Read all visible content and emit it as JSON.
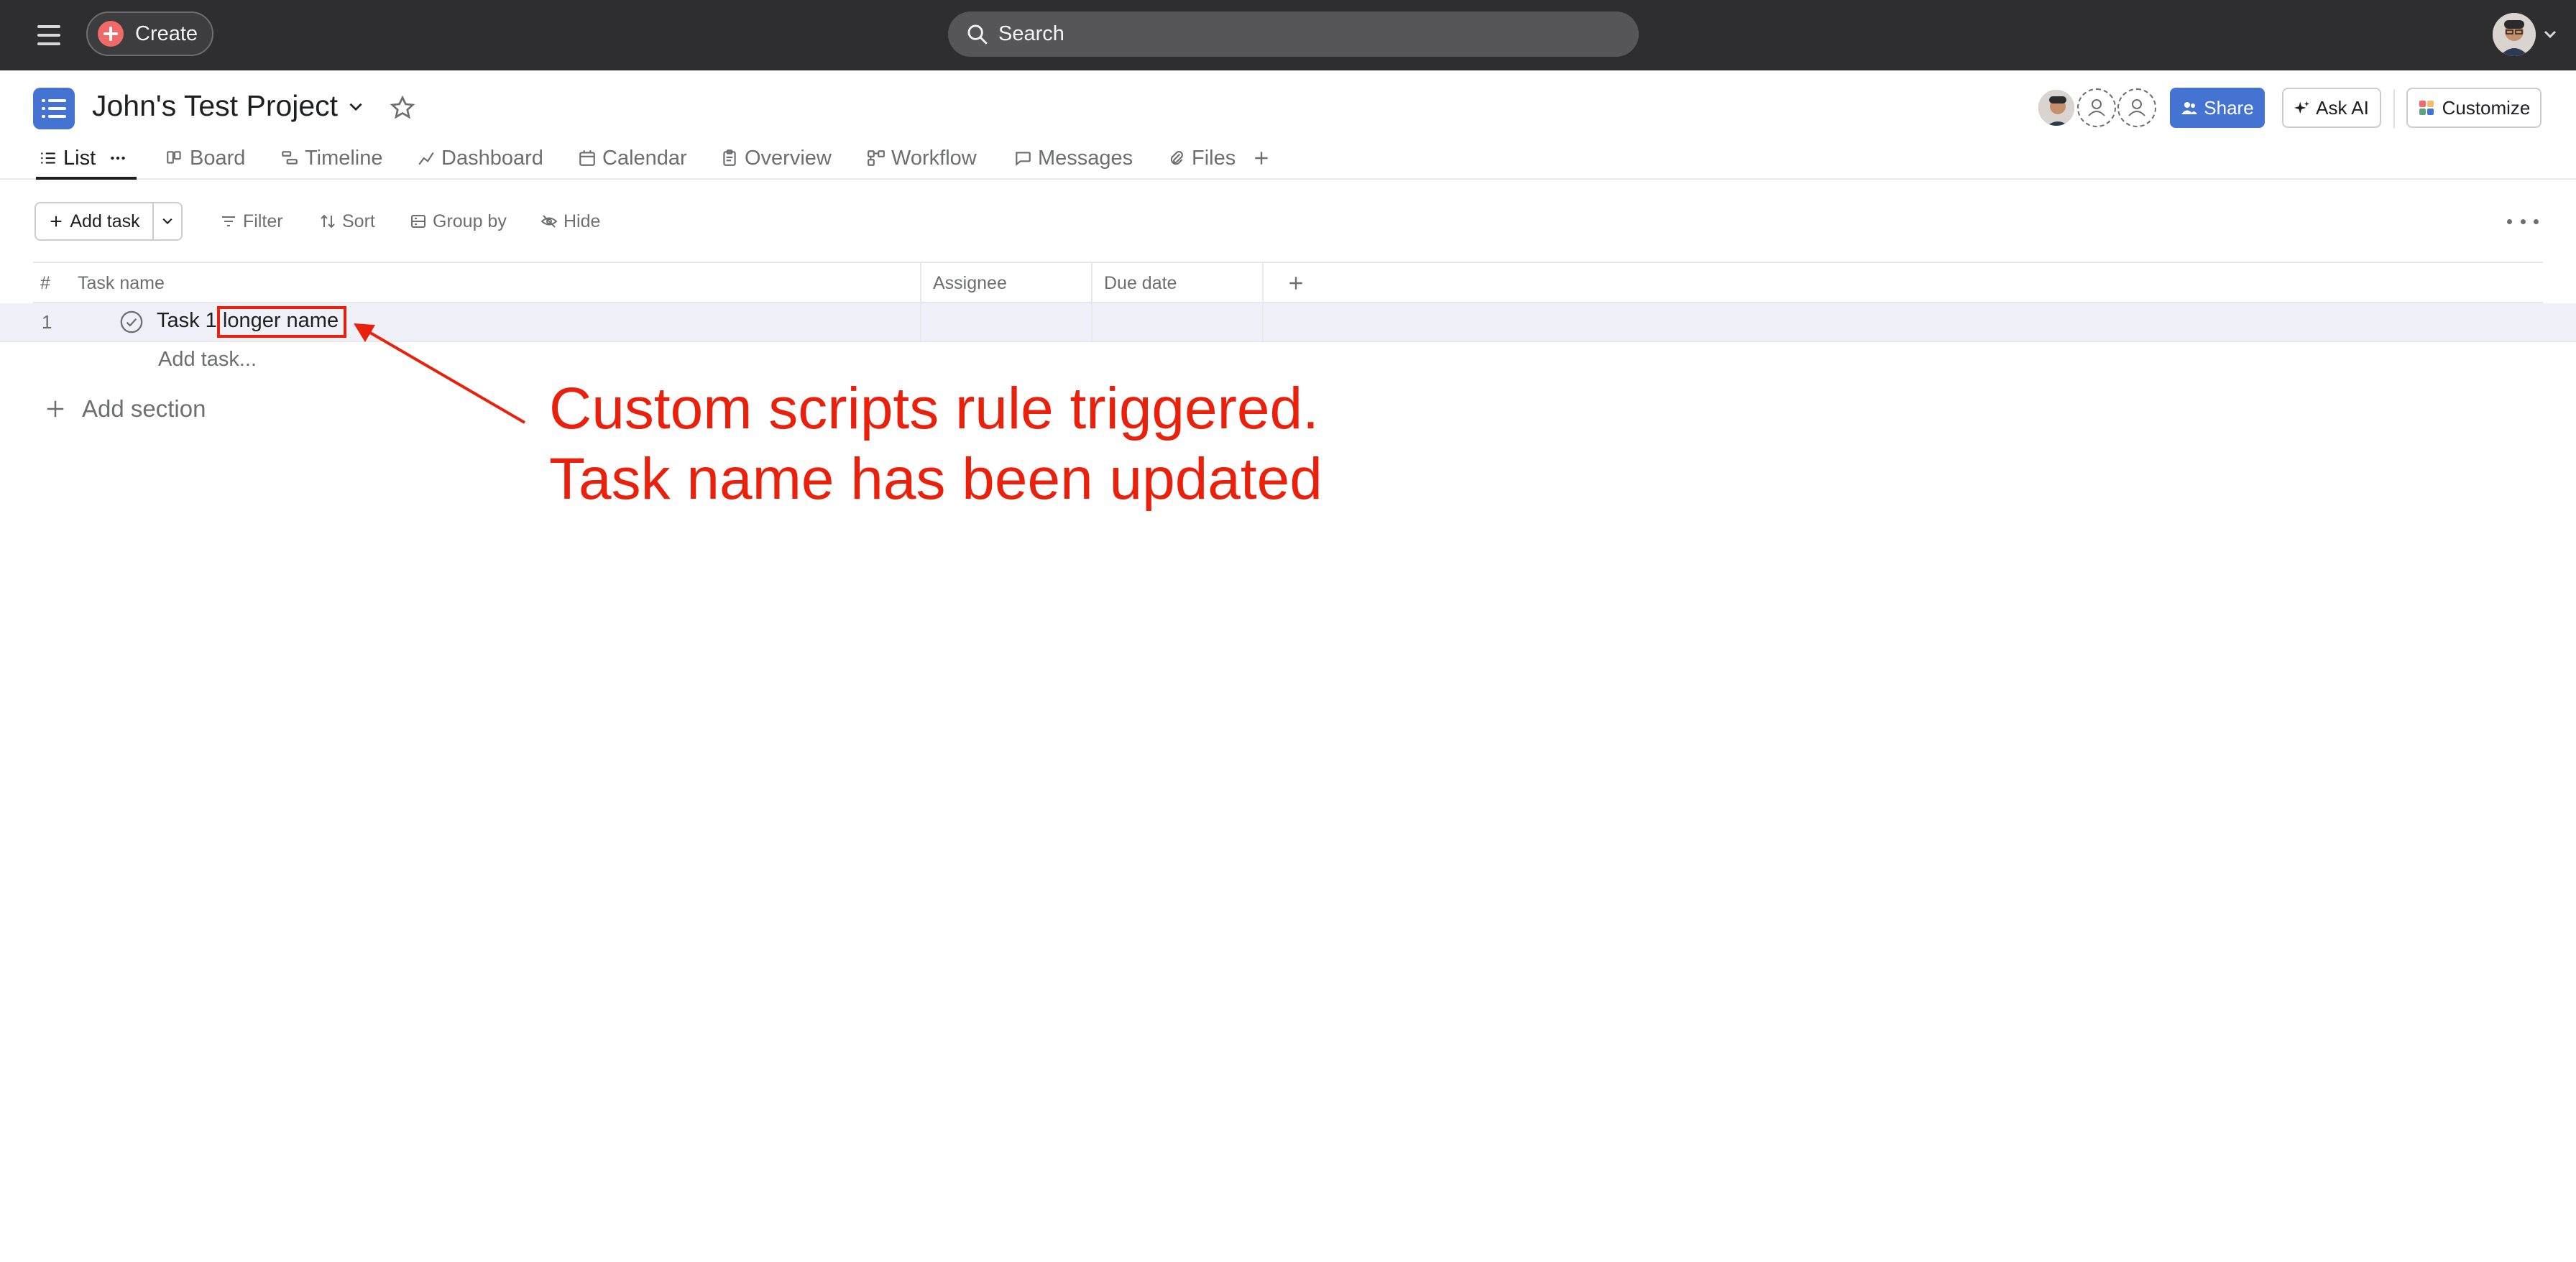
{
  "topbar": {
    "menu_icon": "hamburger-icon",
    "create_label": "Create",
    "search_placeholder": "Search"
  },
  "project": {
    "title": "John's Test Project",
    "icon": "list-icon",
    "share_label": "Share",
    "ask_ai_label": "Ask AI",
    "customize_label": "Customize"
  },
  "tabs": [
    {
      "label": "List",
      "icon": "list-icon",
      "active": true
    },
    {
      "label": "Board",
      "icon": "board-icon"
    },
    {
      "label": "Timeline",
      "icon": "timeline-icon"
    },
    {
      "label": "Dashboard",
      "icon": "dashboard-icon"
    },
    {
      "label": "Calendar",
      "icon": "calendar-icon"
    },
    {
      "label": "Overview",
      "icon": "overview-icon"
    },
    {
      "label": "Workflow",
      "icon": "workflow-icon"
    },
    {
      "label": "Messages",
      "icon": "messages-icon"
    },
    {
      "label": "Files",
      "icon": "paperclip-icon"
    }
  ],
  "toolbar": {
    "add_task_label": "Add task",
    "filter_label": "Filter",
    "sort_label": "Sort",
    "group_by_label": "Group by",
    "hide_label": "Hide"
  },
  "table": {
    "columns": [
      "#",
      "Task name",
      "Assignee",
      "Due date"
    ],
    "rows": [
      {
        "num": "1",
        "name_prefix": "Task 1 ",
        "name_highlight": "longer name",
        "assignee": "",
        "due_date": ""
      }
    ],
    "add_task_placeholder": "Add task...",
    "add_section_label": "Add section"
  },
  "annotation": {
    "line1": "Custom scripts rule triggered.",
    "line2": "Task name has been updated",
    "color": "#e8200c"
  },
  "colors": {
    "topbar": "#2e2e30",
    "accent": "#4573d2",
    "create": "#f06a6a"
  }
}
